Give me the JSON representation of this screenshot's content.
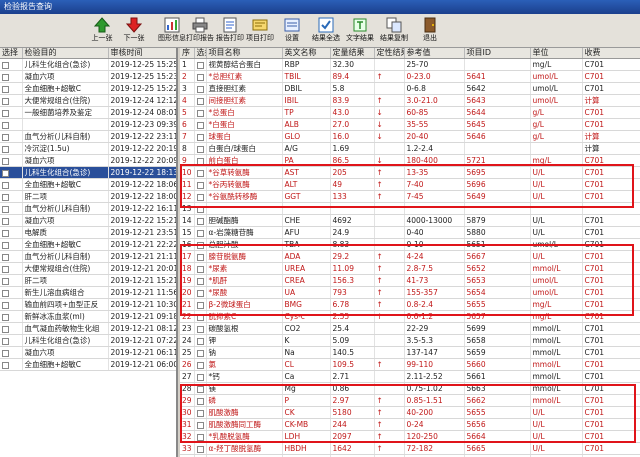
{
  "window": {
    "title": "检验报告查询"
  },
  "toolbar": [
    {
      "label": "上一张",
      "icon": "arrow-up-icon"
    },
    {
      "label": "下一张",
      "icon": "arrow-down-icon"
    },
    {
      "label": "图形信息",
      "icon": "chart-icon"
    },
    {
      "label": "打印报告",
      "icon": "printer-icon"
    },
    {
      "label": "报告打印",
      "icon": "report-icon"
    },
    {
      "label": "项目打印",
      "icon": "item-print-icon"
    },
    {
      "label": "设置",
      "icon": "settings-icon"
    },
    {
      "label": "结果全选",
      "icon": "select-all-icon"
    },
    {
      "label": "文字结果",
      "icon": "text-icon"
    },
    {
      "label": "结果复制",
      "icon": "copy-icon"
    },
    {
      "label": "退出",
      "icon": "exit-icon"
    }
  ],
  "left": {
    "headers": [
      "选择",
      "检验目的",
      "审核时间"
    ],
    "rows": [
      [
        "儿科生化组合(急诊)",
        "2019-12-25 15:25"
      ],
      [
        "凝血六项",
        "2019-12-25 15:23"
      ],
      [
        "全血细胞+超敏C",
        "2019-12-25 15:22"
      ],
      [
        "大便常规组合(住院)",
        "2019-12-24 12:12"
      ],
      [
        "一般细菌培养及鉴定",
        "2019-12-24 08:01"
      ],
      [
        "",
        "2019-12-23 09:39"
      ],
      [
        "血气分析(儿科自制)",
        "2019-12-22 23:11"
      ],
      [
        "冷沉淀(1.5u)",
        "2019-12-22 20:19"
      ],
      [
        "凝血六项",
        "2019-12-22 20:09"
      ],
      [
        "儿科生化组合(急诊)",
        "2019-12-22 18:13"
      ],
      [
        "全血细胞+超敏C",
        "2019-12-22 18:06"
      ],
      [
        "肝二项",
        "2019-12-22 18:00"
      ],
      [
        "血气分析(儿科自制)",
        "2019-12-22 16:11"
      ],
      [
        "凝血六项",
        "2019-12-22 15:21"
      ],
      [
        "电解质",
        "2019-12-21 23:51"
      ],
      [
        "全血细胞+超敏C",
        "2019-12-21 22:22"
      ],
      [
        "血气分析(儿科自制)",
        "2019-12-21 21:11"
      ],
      [
        "大便常规组合(住院)",
        "2019-12-21 20:01"
      ],
      [
        "肝二项",
        "2019-12-21 15:21"
      ],
      [
        "新生儿溶血病组合",
        "2019-12-21 11:56"
      ],
      [
        "输血前四项+血型正反",
        "2019-12-21 10:30"
      ],
      [
        "新鲜冰冻血浆(ml)",
        "2019-12-21 09:18"
      ],
      [
        "血气凝血药敏物生化组",
        "2019-12-21 08:12"
      ],
      [
        "儿科生化组合(急诊)",
        "2019-12-21 07:22"
      ],
      [
        "凝血六项",
        "2019-12-21 06:11"
      ],
      [
        "全血细胞+超敏C",
        "2019-12-21 06:00"
      ]
    ],
    "selected_index": 9
  },
  "right": {
    "headers": [
      "序",
      "选择",
      "项目名称",
      "英文名称",
      "定量结果",
      "定性结果",
      "参考值",
      "项目ID",
      "单位",
      "收费"
    ],
    "rows": [
      [
        "1",
        "视黄醇结合蛋白",
        "RBP",
        "32.30",
        "",
        "25-70",
        "",
        "mg/L",
        "C701"
      ],
      [
        "2",
        "*总胆红素",
        "TBIL",
        "89.4",
        "↑",
        "0-23.0",
        "5641",
        "umol/L",
        "C701"
      ],
      [
        "3",
        "直接胆红素",
        "DBIL",
        "5.8",
        "",
        "0-6.8",
        "5642",
        "umol/L",
        "C701"
      ],
      [
        "4",
        "间接胆红素",
        "IBIL",
        "83.9",
        "↑",
        "3.0-21.0",
        "5643",
        "umol/L",
        "计算"
      ],
      [
        "5",
        "*总蛋白",
        "TP",
        "43.0",
        "↓",
        "60-85",
        "5644",
        "g/L",
        "C701"
      ],
      [
        "6",
        "*白蛋白",
        "ALB",
        "27.0",
        "↓",
        "35-55",
        "5645",
        "g/L",
        "C701"
      ],
      [
        "7",
        "球蛋白",
        "GLO",
        "16.0",
        "↓",
        "20-40",
        "5646",
        "g/L",
        "计算"
      ],
      [
        "8",
        "白蛋白/球蛋白",
        "A/G",
        "1.69",
        "",
        "1.2-2.4",
        "",
        "",
        "计算"
      ],
      [
        "9",
        "前白蛋白",
        "PA",
        "86.5",
        "↓",
        "180-400",
        "5721",
        "mg/L",
        "C701"
      ],
      [
        "10",
        "*谷草转氨酶",
        "AST",
        "205",
        "↑",
        "13-35",
        "5695",
        "U/L",
        "C701"
      ],
      [
        "11",
        "*谷丙转氨酶",
        "ALT",
        "49",
        "↑",
        "7-40",
        "5696",
        "U/L",
        "C701"
      ],
      [
        "12",
        "*谷氨酰转移酶",
        "GGT",
        "133",
        "↑",
        "7-45",
        "5649",
        "U/L",
        "C701"
      ],
      [
        "13",
        "",
        "",
        "",
        "",
        "",
        "",
        "",
        ""
      ],
      [
        "14",
        "胆碱酯酶",
        "CHE",
        "4692",
        "",
        "4000-13000",
        "5879",
        "U/L",
        "C701"
      ],
      [
        "15",
        "α-岩藻糖苷酶",
        "AFU",
        "24.9",
        "",
        "0-40",
        "5880",
        "U/L",
        "C701"
      ],
      [
        "16",
        "总胆汁酸",
        "TBA",
        "8.83",
        "",
        "0-10",
        "5651",
        "umol/L",
        "C701"
      ],
      [
        "17",
        "腺苷脱氨酶",
        "ADA",
        "29.2",
        "↑",
        "4-24",
        "5667",
        "U/L",
        "C701"
      ],
      [
        "18",
        "*尿素",
        "UREA",
        "11.09",
        "↑",
        "2.8-7.5",
        "5652",
        "mmol/L",
        "C701"
      ],
      [
        "19",
        "*肌酐",
        "CREA",
        "156.3",
        "↑",
        "41-73",
        "5653",
        "umol/L",
        "C701"
      ],
      [
        "20",
        "*尿酸",
        "UA",
        "793",
        "↑",
        "155-357",
        "5654",
        "umol/L",
        "C701"
      ],
      [
        "21",
        "β-2微球蛋白",
        "BMG",
        "6.78",
        "↑",
        "0.8-2.4",
        "5655",
        "mg/L",
        "C701"
      ],
      [
        "22",
        "胱抑素C",
        "Cys-c",
        "2.55",
        "↑",
        "0.6-1.2",
        "5657",
        "mg/L",
        "C701"
      ],
      [
        "23",
        "碳酸氢根",
        "CO2",
        "25.4",
        "",
        "22-29",
        "5699",
        "mmol/L",
        "C701"
      ],
      [
        "24",
        "钾",
        "K",
        "5.09",
        "",
        "3.5-5.3",
        "5658",
        "mmol/L",
        "C701"
      ],
      [
        "25",
        "钠",
        "Na",
        "140.5",
        "",
        "137-147",
        "5659",
        "mmol/L",
        "C701"
      ],
      [
        "26",
        "氯",
        "CL",
        "109.5",
        "↑",
        "99-110",
        "5660",
        "mmol/L",
        "C701"
      ],
      [
        "27",
        "*钙",
        "Ca",
        "2.71",
        "",
        "2.11-2.52",
        "5661",
        "mmol/L",
        "C701"
      ],
      [
        "28",
        "镁",
        "Mg",
        "0.86",
        "",
        "0.75-1.02",
        "5663",
        "mmol/L",
        "C701"
      ],
      [
        "29",
        "磷",
        "P",
        "2.97",
        "↑",
        "0.85-1.51",
        "5662",
        "mmol/L",
        "C701"
      ],
      [
        "30",
        "肌酸激酶",
        "CK",
        "5180",
        "↑",
        "40-200",
        "5655",
        "U/L",
        "C701"
      ],
      [
        "31",
        "肌酸激酶同工酶",
        "CK-MB",
        "244",
        "↑",
        "0-24",
        "5656",
        "U/L",
        "C701"
      ],
      [
        "32",
        "*乳酸脱氢酶",
        "LDH",
        "2097",
        "↑",
        "120-250",
        "5664",
        "U/L",
        "C701"
      ],
      [
        "33",
        "α-羟丁酸脱氢酶",
        "HBDH",
        "1642",
        "↑",
        "72-182",
        "5665",
        "U/L",
        "C701"
      ],
      [
        "34",
        "",
        "",
        "",
        "",
        "",
        "",
        "",
        ""
      ]
    ],
    "abnormal_color": "#c01818"
  },
  "colors": {
    "highlight_box": "#e0141a",
    "selection": "#2a4f9a"
  }
}
